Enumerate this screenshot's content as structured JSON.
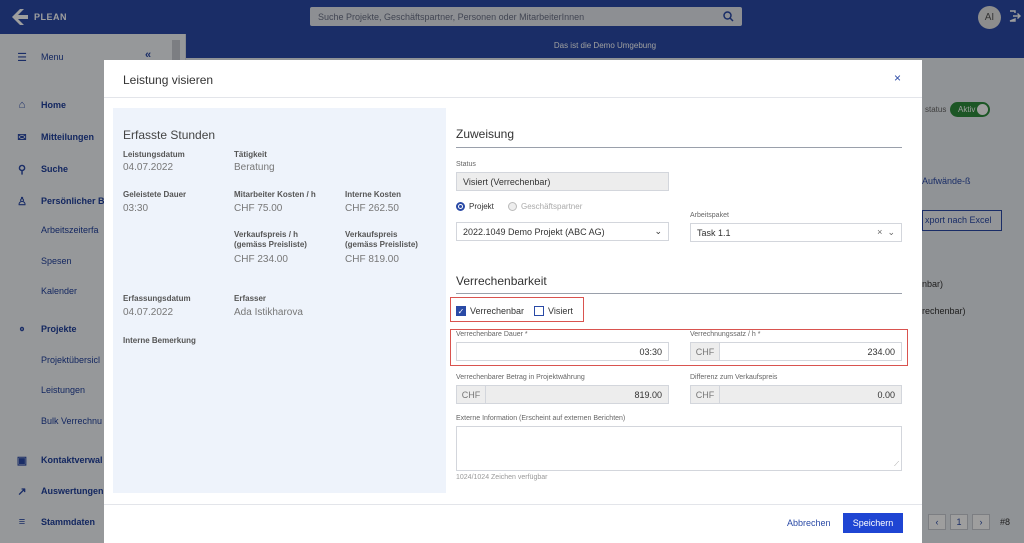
{
  "app": {
    "logo_text": "PLEAN",
    "search_placeholder": "Suche Projekte, Geschäftspartner, Personen oder MitarbeiterInnen",
    "avatar_initials": "AI",
    "demo_banner": "Das ist die Demo Umgebung"
  },
  "sidebar": {
    "menu_label": "Menu",
    "items": [
      {
        "label": "Home",
        "icon": "home-icon"
      },
      {
        "label": "Mitteilungen",
        "icon": "mail-icon"
      },
      {
        "label": "Suche",
        "icon": "search-icon"
      },
      {
        "label": "Persönlicher B",
        "icon": "user-icon"
      },
      {
        "label": "Projekte",
        "icon": "network-icon"
      },
      {
        "label": "Kontaktverwal",
        "icon": "contact-icon"
      },
      {
        "label": "Auswertungen",
        "icon": "chart-icon"
      },
      {
        "label": "Stammdaten",
        "icon": "database-icon"
      }
    ],
    "sub_personal": [
      "Arbeitszeiterfa",
      "Spesen",
      "Kalender"
    ],
    "sub_projects": [
      "Projektübersicl",
      "Leistungen",
      "Bulk Verrechnu"
    ]
  },
  "background": {
    "status_label": "status",
    "toggle_label": "Aktiv",
    "link_label": "Aufwände-ß",
    "export_label": "xport nach Excel",
    "row_texts": [
      "nbar)",
      "rechenbar)"
    ],
    "page_number": "1",
    "page_count": "#8"
  },
  "modal": {
    "title": "Leistung visieren",
    "close": "×",
    "left": {
      "title": "Erfasste Stunden",
      "leistungsdatum_label": "Leistungsdatum",
      "leistungsdatum": "04.07.2022",
      "taetigkeit_label": "Tätigkeit",
      "taetigkeit": "Beratung",
      "dauer_label": "Geleistete Dauer",
      "dauer": "03:30",
      "ma_kosten_label": "Mitarbeiter Kosten / h",
      "ma_kosten": "CHF 75.00",
      "interne_kosten_label": "Interne Kosten",
      "interne_kosten": "CHF 262.50",
      "vp_h_label_1": "Verkaufspreis / h",
      "vp_h_label_2": "(gemäss Preisliste)",
      "vp_h": "CHF 234.00",
      "vp_label_1": "Verkaufspreis",
      "vp_label_2": "(gemäss Preisliste)",
      "vp": "CHF 819.00",
      "erfassungsdatum_label": "Erfassungsdatum",
      "erfassungsdatum": "04.07.2022",
      "erfasser_label": "Erfasser",
      "erfasser": "Ada Istikharova",
      "bemerkung_label": "Interne Bemerkung"
    },
    "zuweisung": {
      "title": "Zuweisung",
      "status_label": "Status",
      "status_value": "Visiert (Verrechenbar)",
      "radio_projekt": "Projekt",
      "radio_partner": "Geschäftspartner",
      "projekt_value": "2022.1049 Demo Projekt (ABC AG)",
      "arbeitspaket_label": "Arbeitspaket",
      "arbeitspaket_value": "Task 1.1"
    },
    "verrechenbarkeit": {
      "title": "Verrechenbarkeit",
      "cb_verrechenbar": "Verrechenbar",
      "cb_visiert": "Visiert",
      "dauer_label": "Verrechenbare Dauer  *",
      "dauer_value": "03:30",
      "satz_label": "Verrechnungssatz / h  *",
      "satz_currency": "CHF",
      "satz_value": "234.00",
      "betrag_label": "Verrechenbarer Betrag in Projektwährung",
      "betrag_currency": "CHF",
      "betrag_value": "819.00",
      "diff_label": "Differenz zum Verkaufspreis",
      "diff_currency": "CHF",
      "diff_value": "0.00",
      "extern_label": "Externe Information (Erscheint auf externen Berichten)",
      "extern_hint": "1024/1024 Zeichen verfügbar"
    },
    "footer": {
      "cancel": "Abbrechen",
      "save": "Speichern"
    }
  },
  "colors": {
    "primary": "#2a4aa6",
    "save_button": "#1f45d3",
    "highlight": "#d9534f",
    "toggle_active": "#2e8c3c"
  }
}
